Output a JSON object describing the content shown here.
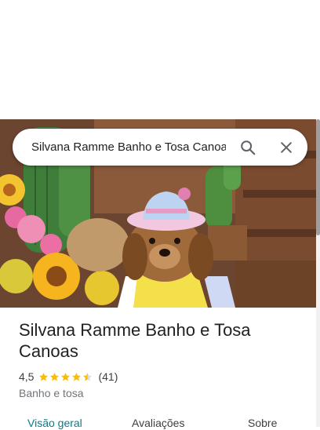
{
  "search": {
    "query": "Silvana Ramme Banho e Tosa Canoas",
    "search_icon": "search-icon",
    "close_icon": "close-icon"
  },
  "place": {
    "name": "Silvana Ramme Banho e Tosa Canoas",
    "rating": "4,5",
    "rating_value": 4.5,
    "review_count": "(41)",
    "category": "Banho e tosa",
    "star_color": "#fbbc04"
  },
  "tabs": [
    {
      "label": "Visão geral",
      "active": true
    },
    {
      "label": "Avaliações",
      "active": false
    },
    {
      "label": "Sobre",
      "active": false
    }
  ],
  "colors": {
    "active_tab": "#0b7a87",
    "text_primary": "#202124",
    "text_secondary": "#70757a"
  }
}
